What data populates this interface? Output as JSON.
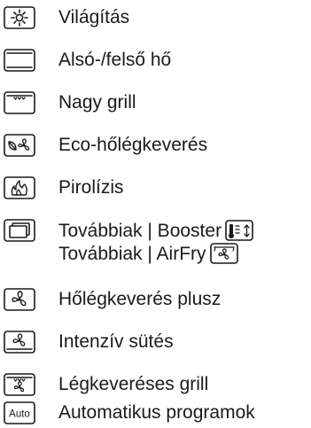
{
  "items": [
    {
      "label": "Világítás",
      "icon": "light-icon"
    },
    {
      "label": "Alsó-/felső hő",
      "icon": "top-bottom-heat-icon"
    },
    {
      "label": "Nagy grill",
      "icon": "large-grill-icon"
    },
    {
      "label": "Eco-hőlégkeverés",
      "icon": "eco-fan-icon"
    },
    {
      "label": "Pirolízis",
      "icon": "pyrolysis-icon"
    },
    {
      "label": "Továbbiak | Booster",
      "label2": "Továbbiak | AirFry",
      "icon": "more-icon"
    },
    {
      "label": "Hőlégkeverés plusz",
      "icon": "fan-plus-icon"
    },
    {
      "label": "Intenzív sütés",
      "icon": "intensive-bake-icon"
    },
    {
      "label": "Légkeveréses grill",
      "icon": "fan-grill-icon"
    },
    {
      "label": "Automatikus programok",
      "icon": "auto-programs-icon",
      "icon_text": "Auto"
    }
  ]
}
